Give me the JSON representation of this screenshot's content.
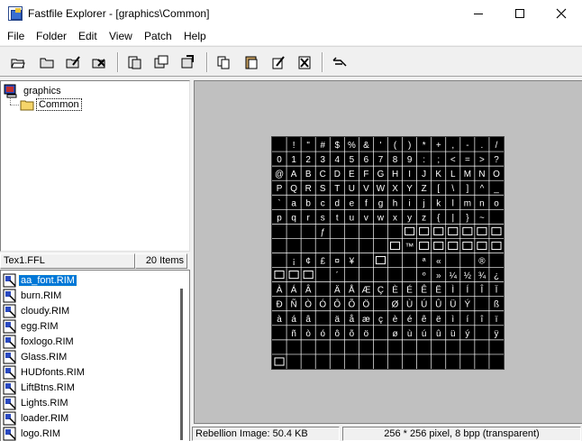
{
  "window": {
    "title": "Fastfile Explorer - [graphics\\Common]"
  },
  "menu": [
    {
      "label": "File"
    },
    {
      "label": "Folder"
    },
    {
      "label": "Edit"
    },
    {
      "label": "View"
    },
    {
      "label": "Patch"
    },
    {
      "label": "Help"
    }
  ],
  "toolbar": {
    "buttons": [
      {
        "icon": "open-folder-icon"
      },
      {
        "icon": "folder-icon"
      },
      {
        "icon": "edit-pencil-icon"
      },
      {
        "icon": "delete-icon"
      },
      {
        "icon": "extract-icon"
      },
      {
        "icon": "import-icon"
      },
      {
        "icon": "properties-icon"
      },
      {
        "icon": "copy-icon"
      },
      {
        "icon": "paste-icon"
      },
      {
        "icon": "patch-edit-icon"
      },
      {
        "icon": "patch-delete-icon"
      },
      {
        "icon": "help-pointer-icon"
      }
    ]
  },
  "tree": {
    "root": "graphics",
    "child": "Common"
  },
  "list_header": {
    "file": "Tex1.FFL",
    "count": "20 Items"
  },
  "files": [
    "aa_font.RIM",
    "burn.RIM",
    "cloudy.RIM",
    "egg.RIM",
    "foxlogo.RIM",
    "Glass.RIM",
    "HUDfonts.RIM",
    "LiftBtns.RIM",
    "Lights.RIM",
    "loader.RIM",
    "logo.RIM"
  ],
  "font_sheet": {
    "rows": [
      [
        "",
        "!",
        "\"",
        "#",
        "$",
        "%",
        "&",
        "'",
        "(",
        ")",
        "*",
        "+",
        ",",
        "-",
        ".",
        "/"
      ],
      [
        "0",
        "1",
        "2",
        "3",
        "4",
        "5",
        "6",
        "7",
        "8",
        "9",
        ":",
        ";",
        "<",
        "=",
        ">",
        "?"
      ],
      [
        "@",
        "A",
        "B",
        "C",
        "D",
        "E",
        "F",
        "G",
        "H",
        "I",
        "J",
        "K",
        "L",
        "M",
        "N",
        "O"
      ],
      [
        "P",
        "Q",
        "R",
        "S",
        "T",
        "U",
        "V",
        "W",
        "X",
        "Y",
        "Z",
        "[",
        "\\",
        "]",
        "^",
        "_"
      ],
      [
        "`",
        "a",
        "b",
        "c",
        "d",
        "e",
        "f",
        "g",
        "h",
        "i",
        "j",
        "k",
        "l",
        "m",
        "n",
        "o"
      ],
      [
        "p",
        "q",
        "r",
        "s",
        "t",
        "u",
        "v",
        "w",
        "x",
        "y",
        "z",
        "{",
        "|",
        "}",
        "~",
        ""
      ],
      [
        "",
        "",
        "",
        "ƒ",
        "",
        "",
        "",
        "",
        "",
        "",
        "",
        "",
        "",
        "",
        "",
        ""
      ],
      [
        "",
        "",
        "",
        "",
        "",
        "",
        "",
        "",
        "",
        "™",
        "",
        "",
        "",
        "",
        "",
        ""
      ],
      [
        "",
        "¡",
        "¢",
        "£",
        "¤",
        "¥",
        "",
        "",
        "",
        "",
        "ª",
        "«",
        "",
        "",
        "®",
        ""
      ],
      [
        "",
        "",
        "",
        "",
        "´",
        "",
        "",
        "",
        "",
        "",
        "º",
        "»",
        "¼",
        "½",
        "¾",
        "¿"
      ],
      [
        "À",
        "Á",
        "Â",
        "",
        "Ä",
        "Å",
        "Æ",
        "Ç",
        "È",
        "É",
        "Ê",
        "Ë",
        "Ì",
        "Í",
        "Î",
        "Ï"
      ],
      [
        "Ð",
        "Ñ",
        "Ò",
        "Ó",
        "Ô",
        "Õ",
        "Ö",
        "",
        "Ø",
        "Ù",
        "Ú",
        "Û",
        "Ü",
        "Ý",
        "",
        "ß"
      ],
      [
        "à",
        "á",
        "â",
        "",
        "ä",
        "å",
        "æ",
        "ç",
        "è",
        "é",
        "ê",
        "ë",
        "ì",
        "í",
        "î",
        "ï"
      ],
      [
        "",
        "ñ",
        "ò",
        "ó",
        "ô",
        "õ",
        "ö",
        "",
        "ø",
        "ù",
        "ú",
        "û",
        "ü",
        "ý",
        "",
        "ÿ"
      ],
      [
        "",
        "",
        "",
        "",
        "",
        "",
        "",
        "",
        "",
        "",
        "",
        "",
        "",
        "",
        "",
        ""
      ],
      [
        "",
        "",
        "",
        "",
        "",
        "",
        "",
        "",
        "",
        "",
        "",
        "",
        "",
        "",
        "",
        ""
      ]
    ]
  },
  "status": {
    "left": "Rebellion Image: 50.4 KB",
    "right": "256 * 256 pixel, 8 bpp (transparent)"
  }
}
